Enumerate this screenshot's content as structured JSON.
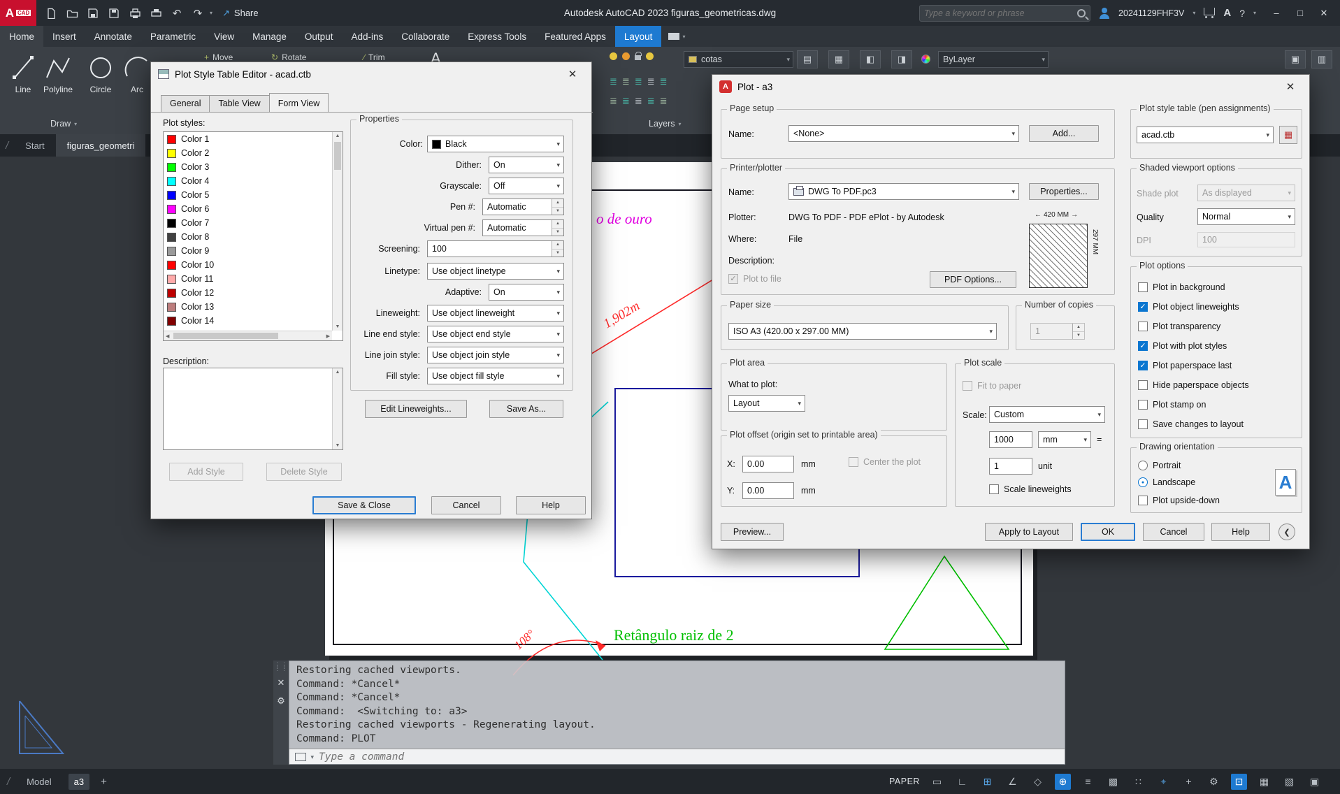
{
  "titlebar": {
    "logo_a": "A",
    "logo_cad": "CAD",
    "share": "Share",
    "app_title": "Autodesk AutoCAD 2023   figuras_geometricas.dwg",
    "search_placeholder": "Type a keyword or phrase",
    "user_id": "20241129FHF3V",
    "help": "?",
    "window": {
      "min": "–",
      "max": "□",
      "close": "✕"
    }
  },
  "ribbon": {
    "tabs": [
      {
        "label": "Home"
      },
      {
        "label": "Insert"
      },
      {
        "label": "Annotate"
      },
      {
        "label": "Parametric"
      },
      {
        "label": "View"
      },
      {
        "label": "Manage"
      },
      {
        "label": "Output"
      },
      {
        "label": "Add-ins"
      },
      {
        "label": "Collaborate"
      },
      {
        "label": "Express Tools"
      },
      {
        "label": "Featured Apps"
      },
      {
        "label": "Layout"
      }
    ],
    "draw": {
      "label": "Draw",
      "tools": [
        {
          "label": "Line"
        },
        {
          "label": "Polyline"
        },
        {
          "label": "Circle"
        },
        {
          "label": "Arc"
        }
      ]
    },
    "modify": {
      "move": "Move",
      "rotate": "Rotate",
      "trim": "Trim",
      "move_ic": "+",
      "rotate_ic": "↻",
      "trim_ic": "∕"
    },
    "annotate_icon": "A",
    "layers": {
      "combo": "cotas",
      "label": "Layers"
    },
    "properties": {
      "bylayer": "ByLayer"
    },
    "misc_icons": [
      {
        "g": "▤"
      },
      {
        "g": "▦"
      },
      {
        "g": "◧"
      },
      {
        "g": "◨"
      }
    ],
    "right_icons": [
      {
        "g": "▣"
      },
      {
        "g": "▥"
      }
    ]
  },
  "file_tabs": {
    "slash": "/",
    "start": "Start",
    "doc": "figuras_geometri"
  },
  "psd": {
    "title": "Plot Style Table Editor - acad.ctb",
    "close": "✕",
    "tabs": [
      "General",
      "Table View",
      "Form View"
    ],
    "styles_label": "Plot styles:",
    "styles": [
      {
        "label": "Color 1",
        "color": "#ff0000"
      },
      {
        "label": "Color 2",
        "color": "#ffff00"
      },
      {
        "label": "Color 3",
        "color": "#00ff00"
      },
      {
        "label": "Color 4",
        "color": "#00ffff"
      },
      {
        "label": "Color 5",
        "color": "#0000ff"
      },
      {
        "label": "Color 6",
        "color": "#ff00ff"
      },
      {
        "label": "Color 7",
        "color": "#000000"
      },
      {
        "label": "Color 8",
        "color": "#414141"
      },
      {
        "label": "Color 9",
        "color": "#9a9a9a"
      },
      {
        "label": "Color 10",
        "color": "#ff0000"
      },
      {
        "label": "Color 11",
        "color": "#ffaaaa"
      },
      {
        "label": "Color 12",
        "color": "#bd0000"
      },
      {
        "label": "Color 13",
        "color": "#bd7e7e"
      },
      {
        "label": "Color 14",
        "color": "#810000"
      }
    ],
    "description_label": "Description:",
    "add_style": "Add Style",
    "delete_style": "Delete Style",
    "props": {
      "group": "Properties",
      "color_l": "Color:",
      "color_v": "Black",
      "dither_l": "Dither:",
      "dither_v": "On",
      "gray_l": "Grayscale:",
      "gray_v": "Off",
      "pen_l": "Pen #:",
      "pen_v": "Automatic",
      "vpen_l": "Virtual pen #:",
      "vpen_v": "Automatic",
      "screen_l": "Screening:",
      "screen_v": "100",
      "lt_l": "Linetype:",
      "lt_v": "Use object linetype",
      "adaptive_l": "Adaptive:",
      "adaptive_v": "On",
      "lw_l": "Lineweight:",
      "lw_v": "Use object lineweight",
      "les_l": "Line end style:",
      "les_v": "Use object end style",
      "ljs_l": "Line join style:",
      "ljs_v": "Use object join style",
      "fs_l": "Fill style:",
      "fs_v": "Use object fill style",
      "edit_lw": "Edit Lineweights...",
      "save_as": "Save As..."
    },
    "save_close": "Save & Close",
    "cancel": "Cancel",
    "help": "Help"
  },
  "pd": {
    "title": "Plot - a3",
    "close": "✕",
    "icon_letter": "A",
    "page_setup": {
      "group": "Page setup",
      "name_l": "Name:",
      "name_v": "<None>",
      "add": "Add..."
    },
    "printer": {
      "group": "Printer/plotter",
      "name_l": "Name:",
      "name_v": "DWG To PDF.pc3",
      "props": "Properties...",
      "plotter_l": "Plotter:",
      "plotter_v": "DWG To PDF - PDF ePlot - by Autodesk",
      "where_l": "Where:",
      "where_v": "File",
      "desc_l": "Description:",
      "ptf": "Plot to file",
      "ptf_mark": "✓",
      "pdf_opts": "PDF Options...",
      "dim_w": "420 MM",
      "dim_h": "297 MM"
    },
    "paper": {
      "group": "Paper size",
      "v": "ISO A3 (420.00 x 297.00 MM)"
    },
    "copies": {
      "group": "Number of copies",
      "v": "1"
    },
    "area": {
      "group": "Plot area",
      "what_l": "What to plot:",
      "what_v": "Layout"
    },
    "offset": {
      "group": "Plot offset (origin set to printable area)",
      "x_l": "X:",
      "x_v": "0.00",
      "y_l": "Y:",
      "y_v": "0.00",
      "unit": "mm",
      "center": "Center the plot",
      "center_mark": ""
    },
    "scale": {
      "group": "Plot scale",
      "fit": "Fit to paper",
      "fit_mark": "",
      "scale_l": "Scale:",
      "scale_v": "Custom",
      "num": "1000",
      "unit_v": "mm",
      "eq": "=",
      "den": "1",
      "unit_l": "unit",
      "slw": "Scale lineweights",
      "slw_mark": ""
    },
    "style_table": {
      "group": "Plot style table (pen assignments)",
      "v": "acad.ctb"
    },
    "shaded": {
      "group": "Shaded viewport options",
      "shade_l": "Shade plot",
      "shade_v": "As displayed",
      "q_l": "Quality",
      "q_v": "Normal",
      "dpi_l": "DPI",
      "dpi_v": "100"
    },
    "options": {
      "group": "Plot options",
      "items": [
        {
          "label": "Plot in background",
          "mark": ""
        },
        {
          "label": "Plot object lineweights",
          "mark": "✓"
        },
        {
          "label": "Plot transparency",
          "mark": ""
        },
        {
          "label": "Plot with plot styles",
          "mark": "✓"
        },
        {
          "label": "Plot paperspace last",
          "mark": "✓"
        },
        {
          "label": "Hide paperspace objects",
          "mark": ""
        },
        {
          "label": "Plot stamp on",
          "mark": ""
        },
        {
          "label": "Save changes to layout",
          "mark": ""
        }
      ]
    },
    "orient": {
      "group": "Drawing orientation",
      "portrait": "Portrait",
      "p_mark": "",
      "landscape": "Landscape",
      "l_mark": "●",
      "upside": "Plot upside-down",
      "u_mark": "",
      "letter": "A"
    },
    "buttons": {
      "preview": "Preview...",
      "apply": "Apply to Layout",
      "ok": "OK",
      "cancel": "Cancel",
      "help": "Help"
    }
  },
  "command": {
    "lines": [
      "Restoring cached viewports.",
      "Command: *Cancel*",
      "Command: *Cancel*",
      "Command:  <Switching to: a3>",
      "Restoring cached viewports - Regenerating layout.",
      "Command: PLOT"
    ],
    "input_placeholder": "Type a command"
  },
  "statusbar": {
    "slash": "/",
    "model": "Model",
    "layout": "a3",
    "plus": "+",
    "paper": "PAPER",
    "icons": [
      {
        "name": "ruler-icon",
        "g": "▭"
      },
      {
        "name": "ortho-icon",
        "g": "∟"
      },
      {
        "name": "snap-icon",
        "g": "⊞"
      },
      {
        "name": "polar-tracking-icon",
        "g": "∠"
      },
      {
        "name": "isodraft-icon",
        "g": "◇"
      },
      {
        "name": "object-snap-icon",
        "g": "⊕"
      },
      {
        "name": "lineweight-icon",
        "g": "≡"
      },
      {
        "name": "transparency-icon",
        "g": "▩"
      },
      {
        "name": "selection-cycling-icon",
        "g": "∷"
      },
      {
        "name": "dynamic-ucs-icon",
        "g": "⌖"
      },
      {
        "name": "annotation-scale-icon",
        "g": "+"
      },
      {
        "name": "workspace-icon",
        "g": "⚙"
      },
      {
        "name": "annotation-monitor-icon",
        "g": "⊡"
      },
      {
        "name": "units-icon",
        "g": "▦"
      },
      {
        "name": "quick-properties-icon",
        "g": "▧"
      },
      {
        "name": "clean-screen-icon",
        "g": "▣"
      }
    ]
  },
  "drawing": {
    "texts": {
      "golden": "o de ouro",
      "dim": "1,902m",
      "root2": "Retângulo raiz de 2",
      "angle": "108°"
    }
  }
}
